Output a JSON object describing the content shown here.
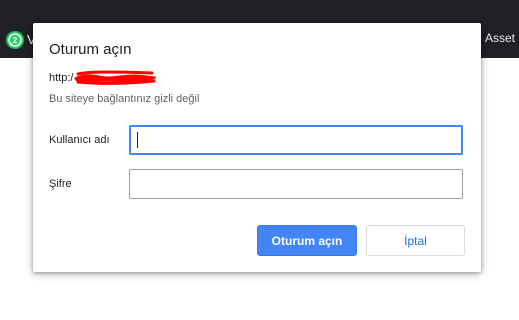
{
  "browser": {
    "bookmarks_left_initial": "V",
    "bookmarks_right_label": "Asset S",
    "whatsapp_icon": "whatsapp-icon",
    "doc_icon": "document-icon"
  },
  "dialog": {
    "title": "Oturum açın",
    "url_prefix": "http:/",
    "url_redacted": true,
    "redaction_color": "#ff0000",
    "connection_warning": "Bu siteye bağlantınız gizli değil",
    "username_label": "Kullanıcı adı",
    "username_value": "",
    "password_label": "Şifre",
    "password_value": "",
    "sign_in_button": "Oturum açın",
    "cancel_button": "İptal"
  },
  "colors": {
    "primary": "#4285f4",
    "focus_border": "#4285f4",
    "cancel_text": "#1a73e8",
    "topbar": "#202124"
  }
}
